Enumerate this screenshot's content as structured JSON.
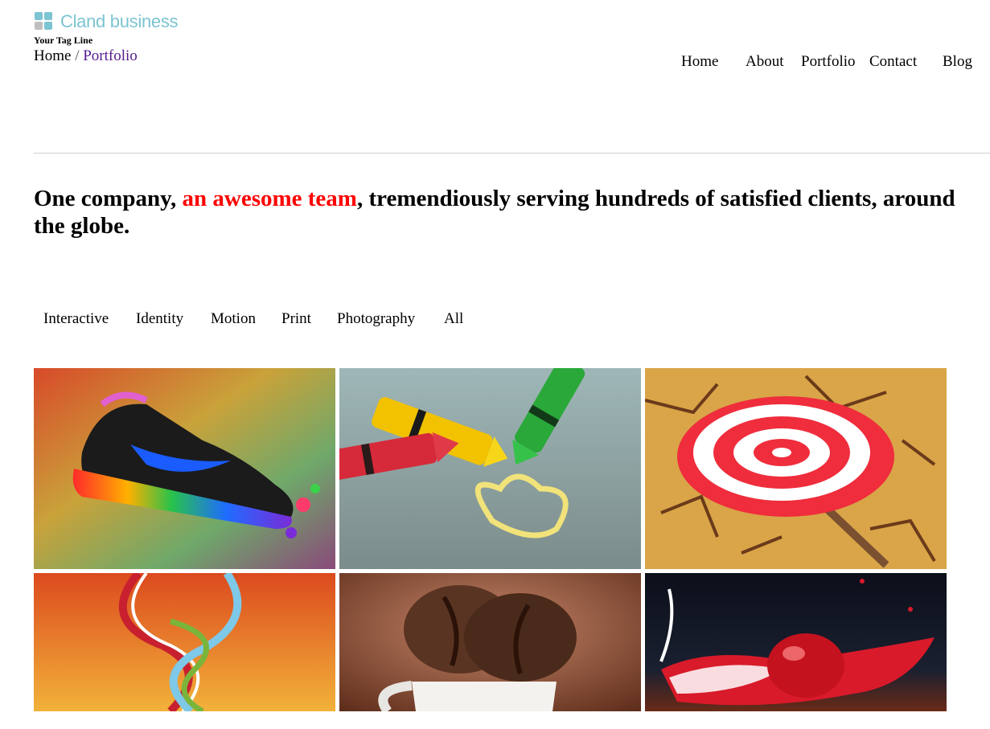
{
  "brand": {
    "name": "Cland business",
    "tagline": "Your Tag Line",
    "logo_color": "#7cc4d2",
    "icon": "grid-squares-icon"
  },
  "breadcrumb": {
    "home": "Home",
    "separator": "/",
    "current": "Portfolio"
  },
  "nav": {
    "items": [
      {
        "label": "Home"
      },
      {
        "label": "About"
      },
      {
        "label": "Portfolio"
      },
      {
        "label": "Contact"
      },
      {
        "label": "Blog"
      }
    ]
  },
  "headline": {
    "before": "One company, ",
    "accent": "an awesome team",
    "after": ", tremendiously serving hundreds of satisfied clients, around the globe.",
    "accent_color": "#ff0000"
  },
  "filters": {
    "items": [
      {
        "label": "Interactive"
      },
      {
        "label": "Identity"
      },
      {
        "label": "Motion"
      },
      {
        "label": "Print"
      },
      {
        "label": "Photography"
      },
      {
        "label": "All"
      }
    ]
  },
  "portfolio": {
    "items": [
      {
        "image": "rainbow-sneaker"
      },
      {
        "image": "crayons-heart"
      },
      {
        "image": "swirl-lollipop"
      },
      {
        "image": "abstract-ribbons"
      },
      {
        "image": "coffee-beans-cup"
      },
      {
        "image": "cherry-milk-splash"
      }
    ]
  },
  "colors": {
    "link_visited": "#551a8b",
    "divider": "#cfcfcf"
  }
}
